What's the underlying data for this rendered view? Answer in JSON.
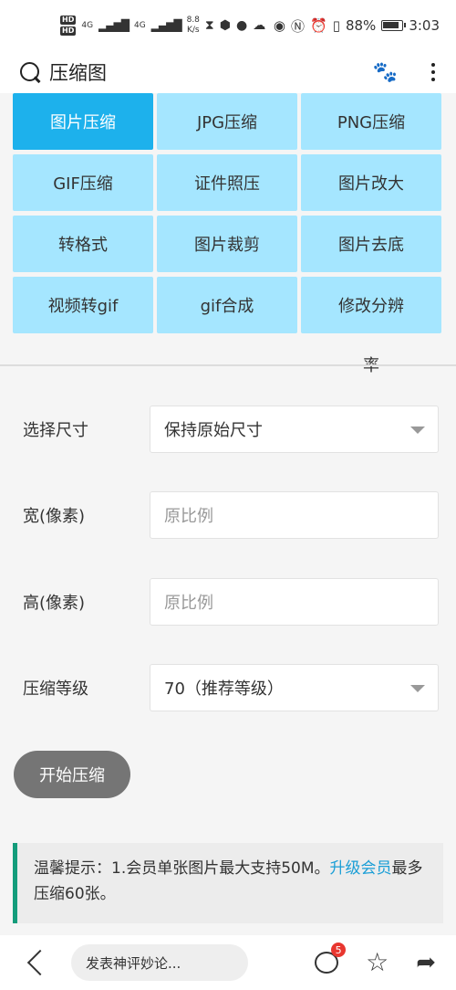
{
  "status_bar": {
    "hd1": "HD",
    "hd2": "HD",
    "net1": "4G",
    "net2": "4G",
    "speed_value": "8.8",
    "speed_unit": "K/s",
    "battery": "88%",
    "time": "3:03"
  },
  "header": {
    "title": "压缩图"
  },
  "tools": [
    {
      "label": "图片压缩",
      "active": true
    },
    {
      "label": "JPG压缩",
      "active": false
    },
    {
      "label": "PNG压缩",
      "active": false
    },
    {
      "label": "GIF压缩",
      "active": false
    },
    {
      "label": "证件照压",
      "active": false
    },
    {
      "label": "图片改大",
      "active": false
    },
    {
      "label": "转格式",
      "active": false
    },
    {
      "label": "图片裁剪",
      "active": false
    },
    {
      "label": "图片去底",
      "active": false
    },
    {
      "label": "视频转gif",
      "active": false
    },
    {
      "label": "gif合成",
      "active": false
    },
    {
      "label": "修改分辨",
      "active": false
    }
  ],
  "tools_overflow_text": "率",
  "form": {
    "size": {
      "label": "选择尺寸",
      "value": "保持原始尺寸"
    },
    "width": {
      "label": "宽(像素)",
      "placeholder": "原比例"
    },
    "height": {
      "label": "高(像素)",
      "placeholder": "原比例"
    },
    "level": {
      "label": "压缩等级",
      "value": "70（推荐等级）"
    }
  },
  "start_button": "开始压缩",
  "tip": {
    "prefix": "温馨提示：1.会员单张图片最大支持50M。",
    "link": "升级会员",
    "suffix": "最多压缩60张。"
  },
  "bottom_bar": {
    "comment_placeholder": "发表神评妙论...",
    "comment_badge": "5"
  },
  "icons": {
    "search": "search-icon",
    "paw": "paw-icon",
    "more": "more-vertical-icon",
    "back": "back-icon",
    "comment": "comment-icon",
    "star": "star-icon",
    "share": "share-icon"
  },
  "colors": {
    "tile": "#a5e6ff",
    "tile_active": "#1db1ec",
    "tip_accent": "#149c7b",
    "link": "#1a9ed6",
    "badge": "#e8362f"
  }
}
